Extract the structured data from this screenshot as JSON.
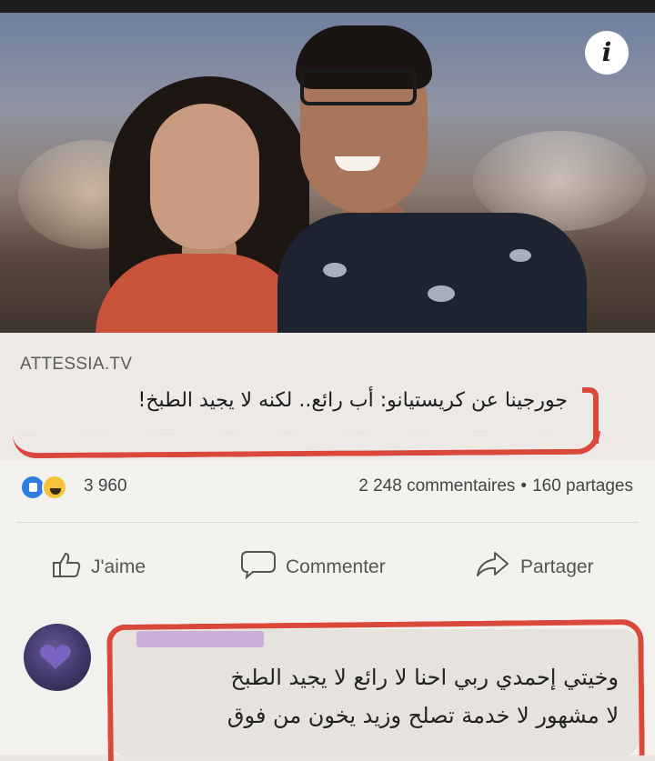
{
  "post": {
    "source": "ATTESSIA.TV",
    "headline": "جورجينا عن كريستيانو: أب رائع.. لكنه لا يجيد الطبخ!",
    "info_icon_label": "i"
  },
  "stats": {
    "reaction_count": "3 960",
    "comments": "2 248 commentaires",
    "separator": "•",
    "shares": "160 partages",
    "reactions": [
      "like-icon",
      "haha-icon"
    ]
  },
  "actions": {
    "like": "J'aime",
    "comment": "Commenter",
    "share": "Partager"
  },
  "comment": {
    "text_line1": "وخيتي إحمدي ربي احنا لا رائع لا يجيد الطبخ",
    "text_line2": "لا مشهور لا خدمة تصلح وزيد يخون من فوق"
  },
  "colors": {
    "annotation_red": "#d9483b",
    "like_blue": "#2d7be3",
    "haha_yellow": "#f5c33b"
  }
}
